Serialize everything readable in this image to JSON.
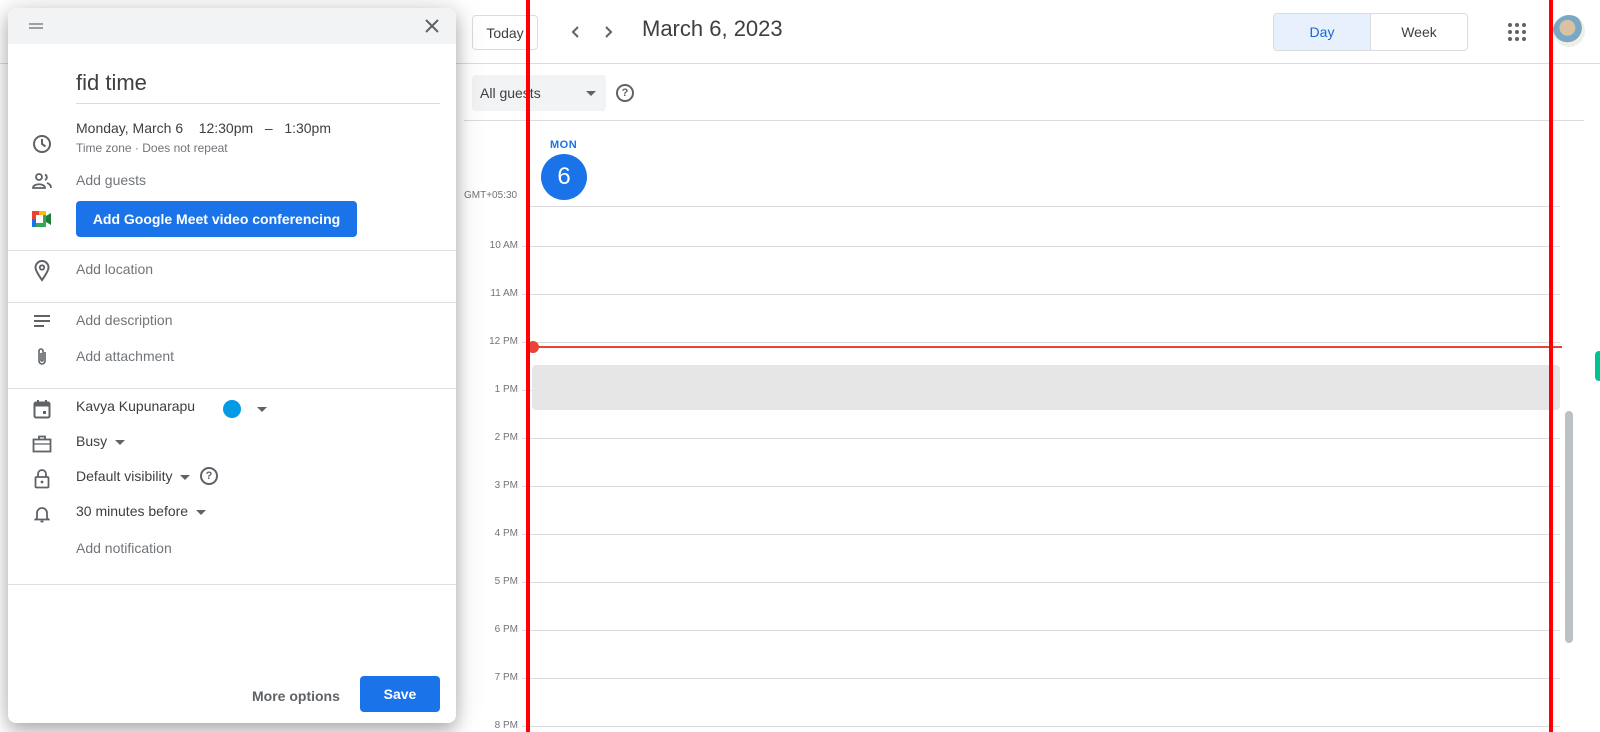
{
  "header": {
    "today_label": "Today",
    "prev_icon": "chevron-left-icon",
    "next_icon": "chevron-right-icon",
    "date_title": "March 6, 2023",
    "views": [
      {
        "label": "Day",
        "active": true
      },
      {
        "label": "Week",
        "active": false
      }
    ],
    "apps_icon": "apps-grid-icon",
    "avatar_icon": "account-avatar"
  },
  "subbar": {
    "guests_select": "All guests",
    "help_icon": "help-circle-icon"
  },
  "day": {
    "weekday": "MON",
    "number": "6",
    "timezone": "GMT+05:30"
  },
  "hours": [
    "10 AM",
    "11 AM",
    "12 PM",
    "1 PM",
    "2 PM",
    "3 PM",
    "4 PM",
    "5 PM",
    "6 PM",
    "7 PM",
    "8 PM"
  ],
  "dialog": {
    "title": "fid time",
    "date": "Monday, March 6",
    "start_time": "12:30pm",
    "time_separator": "–",
    "end_time": "1:30pm",
    "time_sub": "Time zone · Does not repeat",
    "add_guests": "Add guests",
    "meet_button": "Add Google Meet video conferencing",
    "add_location": "Add location",
    "add_description": "Add description",
    "add_attachment": "Add attachment",
    "calendar_owner": "Kavya Kupunarapu",
    "calendar_color": "#039be5",
    "availability": "Busy",
    "visibility": "Default visibility",
    "notification": "30 minutes before",
    "add_notification": "Add notification",
    "more_options": "More options",
    "save": "Save"
  },
  "colors": {
    "accent": "#1a73e8",
    "now_indicator": "#ea4335",
    "event_placeholder": "#e6e6e6"
  }
}
